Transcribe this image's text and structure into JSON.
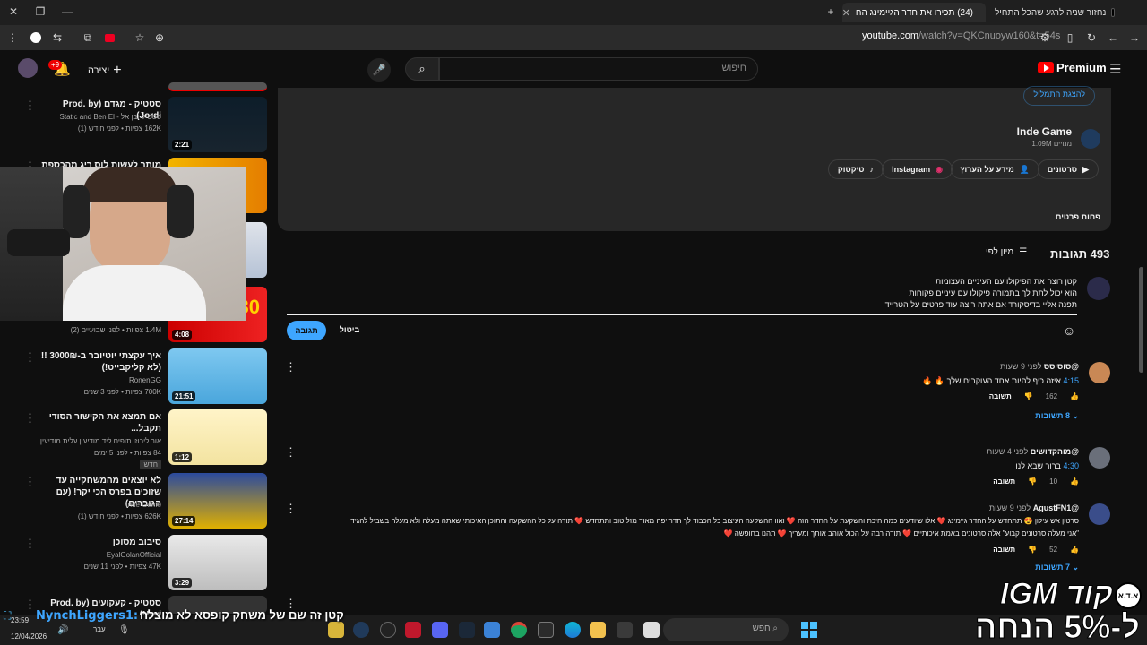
{
  "browser": {
    "tabs": [
      {
        "title": "נחזור שניה לרגע שהכל התחיל",
        "active": false
      },
      {
        "title": "(24) תכירו את חדר הגיימינג הח",
        "active": true
      }
    ],
    "url_domain": "youtube.com",
    "url_rest": "/watch?v=QKCnuoyw160&t=54s"
  },
  "youtube": {
    "brand": "Premium",
    "search_placeholder": "חיפוש",
    "create_label": "יצירה",
    "notif_count": "+9"
  },
  "channel": {
    "show_playlist": "להצגת התמליל",
    "name": "Inde Game",
    "subscribers": "1.09M מנויים",
    "links": [
      "סרטונים",
      "מידע על הערוץ",
      "Instagram",
      "טיקטוק"
    ],
    "less": "פחות פרטים"
  },
  "comments": {
    "count": "493 תגובות",
    "sort": "מיון לפי",
    "draft_lines": [
      "קטן רוצה את הפיקולו עם העיניים העצומות",
      "הוא יכול לתת לך בתמורה פיקולו עם עיניים פקוחות",
      "תפנה אליי בדיסקורד אם אתה רוצה עוד פרטים על הטרייד"
    ],
    "cancel": "ביטול",
    "reply_btn": "תגובה",
    "items": [
      {
        "author": "@סוסיסס",
        "time": "לפני 9 שעות",
        "ts": "4:15",
        "text": "איזה כיף להיות אחד העוקבים שלך 🔥 🔥",
        "likes": "162",
        "reply": "תשובה",
        "replies": "8 תשובות"
      },
      {
        "author": "@מוהקדושים",
        "time": "לפני 4 שעות",
        "ts": "4:30",
        "text": "ברור שבא לנו",
        "likes": "10",
        "reply": "תשובה"
      },
      {
        "author": "@AgustFN1",
        "time": "לפני 9 שעות",
        "text1": "סרטון אש עילון 😍 תתחדש על החדר גיימינג ❤️ אלו שיודעים כמה חיכת והשקעת על החדר הזה ❤️ ואוו ההשקעה העיצוב כל הכבוד לך חדר יפה מאוד מזל טוב ותתחדש ❤️ תודה על כל ההשקעה והתוכן האיכותי שאתה מעלה ולא מעלה בשביל להגיד",
        "text2": "\"אני מעלה סרטונים קבוע\" אלה סרטונים באמת איכותיים ❤️ תודה רבה על הכול אוהב אותך ומעריך ❤️ תהנו בחופשה ❤️",
        "likes": "52",
        "reply": "תשובה",
        "replies": "7 תשובות"
      }
    ]
  },
  "sidebar_videos": [
    {
      "title": "סטטיק - מגדם (Prod. by Jordi)",
      "channel": "סטטיק ובן אל - Static and Ben El",
      "meta": "162K צפיות • לפני חודש (1)",
      "duration": "2:21"
    },
    {
      "title": "מותר לעשות לוס ריג מהכספת של",
      "channel": "",
      "meta": "",
      "duration": ""
    },
    {
      "title": "",
      "channel": "",
      "meta": "1.4M צפיות • לפני שבועיים (2)",
      "duration": "4:08"
    },
    {
      "title": "איך עקצתי יוטיובר ב-3000₪ !! (לא קליקבייט!)",
      "channel": "RonenGG",
      "meta": "700K צפיות • לפני 3 שנים",
      "duration": "21:51"
    },
    {
      "title": "אם תמצא את הקישור הסודי תקבל...",
      "channel": "אור ליבוזו תופים ליד מודיעין עלית מודיעין",
      "meta": "84 צפיות • לפני 5 ימים",
      "badge": "חדש",
      "duration": "1:12"
    },
    {
      "title": "לא יוצאים מהמשחקייה עד שזוכים בפרס הכי יקר! (עם הגוברים)",
      "channel": "Inde Game",
      "meta": "626K צפיות • לפני חודש (1)",
      "duration": "27:14"
    },
    {
      "title": "סיבוב מסוכן",
      "channel": "EyalGolanOfficial",
      "meta": "47K צפיות • לפני 11 שנים",
      "duration": "3:29"
    },
    {
      "title": "סטטיק - קעקועים (Prod. by Navi)",
      "channel": "",
      "meta": "",
      "duration": ""
    }
  ],
  "overlay": {
    "stream_user": "NynchLiggers1:",
    "stream_msg": "קטן זה שם של משחק קופסא לא מוצלח",
    "promo_top": "קוד IGM",
    "promo_bottom": "ל-5% הנחה"
  },
  "taskbar": {
    "search": "חפש",
    "time": "23:59",
    "date": "12/04/2026",
    "lang": "עבר"
  }
}
